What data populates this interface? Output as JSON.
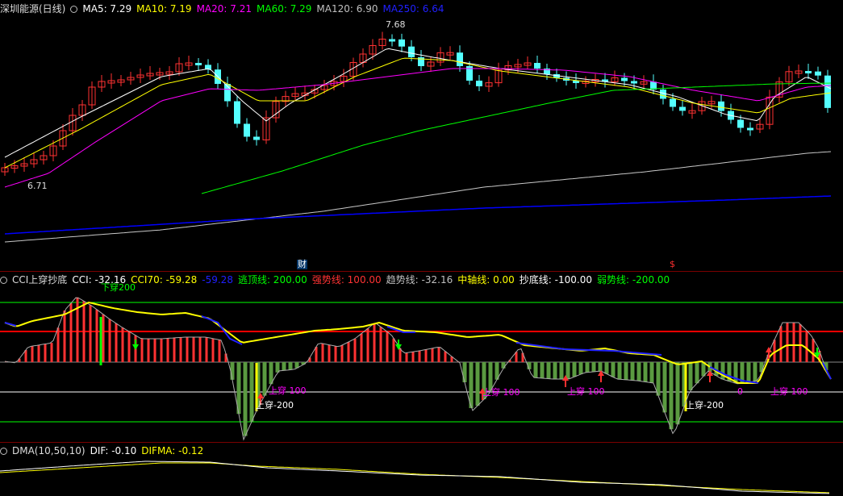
{
  "main": {
    "title": "深圳能源(日线)",
    "ma_labels": [
      "MA5: 7.29",
      "MA10: 7.19",
      "MA20: 7.21",
      "MA60: 7.29",
      "MA120: 6.90",
      "MA250: 6.64"
    ],
    "ma_colors": [
      "#ffffff",
      "#ffff00",
      "#ff00ff",
      "#00ff00",
      "#c0c0c0",
      "#0000ff"
    ],
    "high_label": "7.68",
    "low_label": "6.71",
    "marker_cai": "财",
    "marker_s": "$"
  },
  "cci": {
    "title": "CCI上穿抄底",
    "values": [
      "CCI: -32.16",
      "CCI70: -59.28",
      "-59.28",
      "逃顶线: 200.00",
      "强势线: 100.00",
      "趋势线: -32.16",
      "中轴线: 0.00",
      "抄底线: -100.00",
      "弱势线: -200.00"
    ],
    "value_colors": [
      "#ffffff",
      "#ffff00",
      "#0000ff",
      "#00ff00",
      "#ff0000",
      "#c0c0c0",
      "#ffff00",
      "#ffffff",
      "#00ff00"
    ],
    "top_annotation": "下穿200",
    "ann_up100": "上穿 100",
    "ann_up_neg200": "上穿-200",
    "ann_up_0": "0"
  },
  "dma": {
    "title": "DMA(10,50,10)",
    "values": [
      "DIF: -0.10",
      "DIFMA: -0.12"
    ],
    "value_colors": [
      "#ffffff",
      "#ffff00"
    ]
  },
  "colors": {
    "up": "#ff3232",
    "down": "#54ffff",
    "background": "#000000",
    "divider": "#800000"
  }
}
